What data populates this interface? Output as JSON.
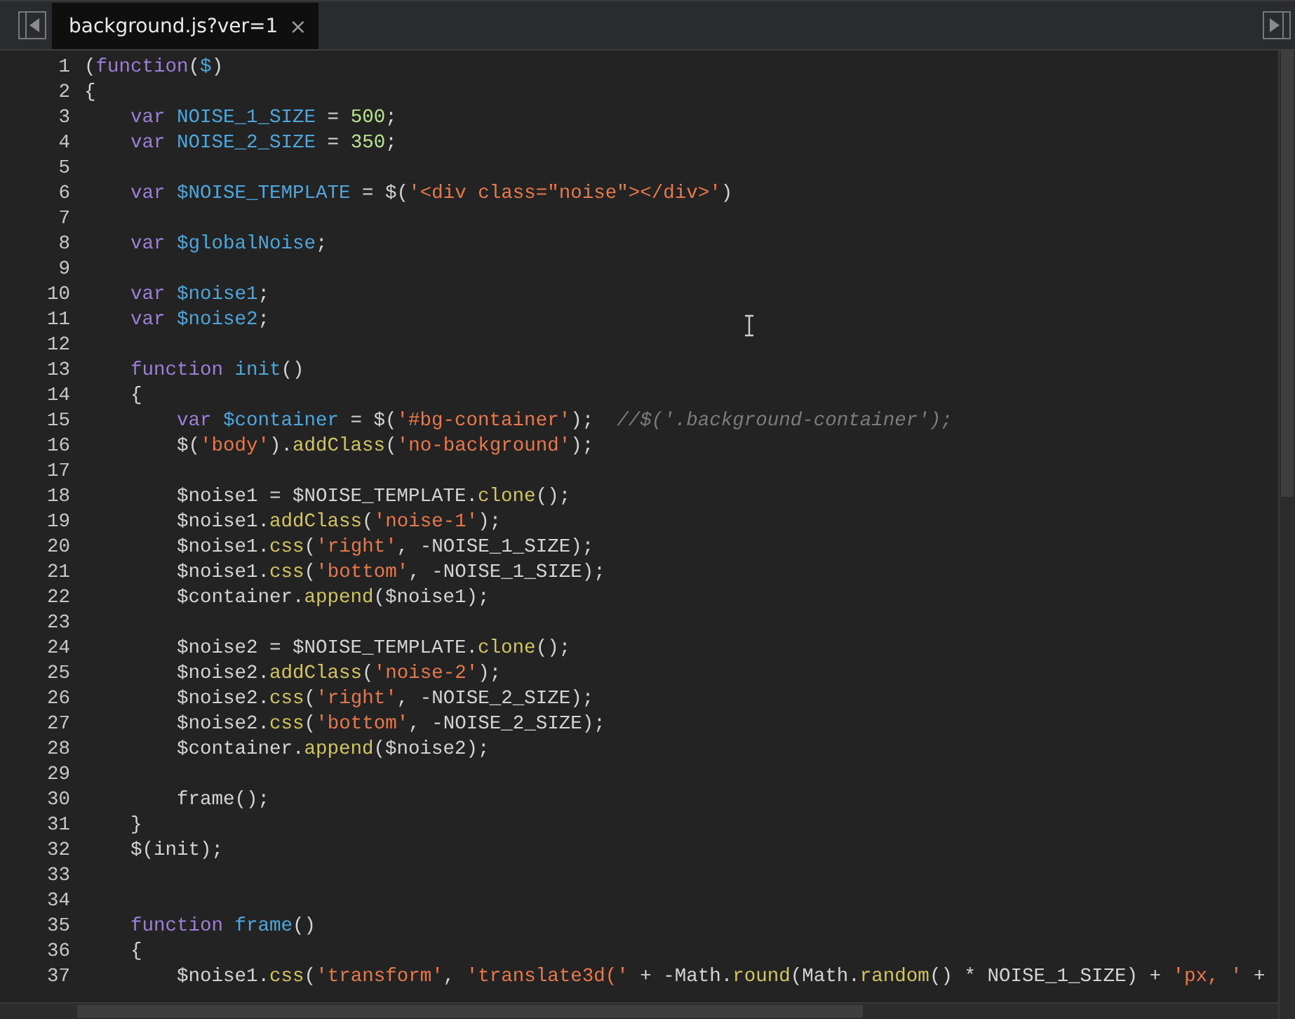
{
  "tabs": [
    {
      "label": "background.js?ver=1",
      "close": "×",
      "selected": true
    }
  ],
  "code_lines": [
    {
      "number": "1",
      "tokens": [
        {
          "kind": "plain",
          "text": "("
        },
        {
          "kind": "keyword",
          "text": "function"
        },
        {
          "kind": "plain",
          "text": "("
        },
        {
          "kind": "ident",
          "text": "$"
        },
        {
          "kind": "plain",
          "text": ")"
        }
      ]
    },
    {
      "number": "2",
      "tokens": [
        {
          "kind": "plain",
          "text": "{"
        }
      ]
    },
    {
      "number": "3",
      "tokens": [
        {
          "kind": "keyword",
          "text": "    var"
        },
        {
          "kind": "ident",
          "text": " NOISE_1_SIZE"
        },
        {
          "kind": "plain",
          "text": " = "
        },
        {
          "kind": "number",
          "text": "500"
        },
        {
          "kind": "plain",
          "text": ";"
        }
      ]
    },
    {
      "number": "4",
      "tokens": [
        {
          "kind": "keyword",
          "text": "    var"
        },
        {
          "kind": "ident",
          "text": " NOISE_2_SIZE"
        },
        {
          "kind": "plain",
          "text": " = "
        },
        {
          "kind": "number",
          "text": "350"
        },
        {
          "kind": "plain",
          "text": ";"
        }
      ]
    },
    {
      "number": "5"
    },
    {
      "number": "6",
      "tokens": [
        {
          "kind": "keyword",
          "text": "    var"
        },
        {
          "kind": "ident",
          "text": " $NOISE_TEMPLATE"
        },
        {
          "kind": "plain",
          "text": " = $("
        },
        {
          "kind": "string",
          "text": "'<div class=\"noise\"></div>'"
        },
        {
          "kind": "plain",
          "text": ")"
        }
      ]
    },
    {
      "number": "7"
    },
    {
      "number": "8",
      "tokens": [
        {
          "kind": "keyword",
          "text": "    var"
        },
        {
          "kind": "ident",
          "text": " $globalNoise"
        },
        {
          "kind": "plain",
          "text": ";"
        }
      ]
    },
    {
      "number": "9"
    },
    {
      "number": "10",
      "tokens": [
        {
          "kind": "keyword",
          "text": "    var"
        },
        {
          "kind": "ident",
          "text": " $noise1"
        },
        {
          "kind": "plain",
          "text": ";"
        }
      ]
    },
    {
      "number": "11",
      "tokens": [
        {
          "kind": "keyword",
          "text": "    var"
        },
        {
          "kind": "ident",
          "text": " $noise2"
        },
        {
          "kind": "plain",
          "text": ";"
        }
      ]
    },
    {
      "number": "12"
    },
    {
      "number": "13",
      "tokens": [
        {
          "kind": "keyword",
          "text": "    function"
        },
        {
          "kind": "ident",
          "text": " init"
        },
        {
          "kind": "plain",
          "text": "()"
        }
      ]
    },
    {
      "number": "14",
      "tokens": [
        {
          "kind": "plain",
          "text": "    {"
        }
      ]
    },
    {
      "number": "15",
      "tokens": [
        {
          "kind": "keyword",
          "text": "        var"
        },
        {
          "kind": "ident",
          "text": " $container"
        },
        {
          "kind": "plain",
          "text": " = $("
        },
        {
          "kind": "string",
          "text": "'#bg-container'"
        },
        {
          "kind": "plain",
          "text": ");"
        },
        {
          "kind": "comment",
          "text": "  //$('.background-container');"
        }
      ]
    },
    {
      "number": "16",
      "tokens": [
        {
          "kind": "plain",
          "text": "        $("
        },
        {
          "kind": "string",
          "text": "'body'"
        },
        {
          "kind": "plain",
          "text": ")."
        },
        {
          "kind": "method",
          "text": "addClass"
        },
        {
          "kind": "plain",
          "text": "("
        },
        {
          "kind": "string",
          "text": "'no-background'"
        },
        {
          "kind": "plain",
          "text": ");"
        }
      ]
    },
    {
      "number": "17"
    },
    {
      "number": "18",
      "tokens": [
        {
          "kind": "plain",
          "text": "        $noise1 = $NOISE_TEMPLATE."
        },
        {
          "kind": "method",
          "text": "clone"
        },
        {
          "kind": "plain",
          "text": "();"
        }
      ]
    },
    {
      "number": "19",
      "tokens": [
        {
          "kind": "plain",
          "text": "        $noise1."
        },
        {
          "kind": "method",
          "text": "addClass"
        },
        {
          "kind": "plain",
          "text": "("
        },
        {
          "kind": "string",
          "text": "'noise-1'"
        },
        {
          "kind": "plain",
          "text": ");"
        }
      ]
    },
    {
      "number": "20",
      "tokens": [
        {
          "kind": "plain",
          "text": "        $noise1."
        },
        {
          "kind": "method",
          "text": "css"
        },
        {
          "kind": "plain",
          "text": "("
        },
        {
          "kind": "string",
          "text": "'right'"
        },
        {
          "kind": "plain",
          "text": ", -NOISE_1_SIZE);"
        }
      ]
    },
    {
      "number": "21",
      "tokens": [
        {
          "kind": "plain",
          "text": "        $noise1."
        },
        {
          "kind": "method",
          "text": "css"
        },
        {
          "kind": "plain",
          "text": "("
        },
        {
          "kind": "string",
          "text": "'bottom'"
        },
        {
          "kind": "plain",
          "text": ", -NOISE_1_SIZE);"
        }
      ]
    },
    {
      "number": "22",
      "tokens": [
        {
          "kind": "plain",
          "text": "        $container."
        },
        {
          "kind": "method",
          "text": "append"
        },
        {
          "kind": "plain",
          "text": "($noise1);"
        }
      ]
    },
    {
      "number": "23"
    },
    {
      "number": "24",
      "tokens": [
        {
          "kind": "plain",
          "text": "        $noise2 = $NOISE_TEMPLATE."
        },
        {
          "kind": "method",
          "text": "clone"
        },
        {
          "kind": "plain",
          "text": "();"
        }
      ]
    },
    {
      "number": "25",
      "tokens": [
        {
          "kind": "plain",
          "text": "        $noise2."
        },
        {
          "kind": "method",
          "text": "addClass"
        },
        {
          "kind": "plain",
          "text": "("
        },
        {
          "kind": "string",
          "text": "'noise-2'"
        },
        {
          "kind": "plain",
          "text": ");"
        }
      ]
    },
    {
      "number": "26",
      "tokens": [
        {
          "kind": "plain",
          "text": "        $noise2."
        },
        {
          "kind": "method",
          "text": "css"
        },
        {
          "kind": "plain",
          "text": "("
        },
        {
          "kind": "string",
          "text": "'right'"
        },
        {
          "kind": "plain",
          "text": ", -NOISE_2_SIZE);"
        }
      ]
    },
    {
      "number": "27",
      "tokens": [
        {
          "kind": "plain",
          "text": "        $noise2."
        },
        {
          "kind": "method",
          "text": "css"
        },
        {
          "kind": "plain",
          "text": "("
        },
        {
          "kind": "string",
          "text": "'bottom'"
        },
        {
          "kind": "plain",
          "text": ", -NOISE_2_SIZE);"
        }
      ]
    },
    {
      "number": "28",
      "tokens": [
        {
          "kind": "plain",
          "text": "        $container."
        },
        {
          "kind": "method",
          "text": "append"
        },
        {
          "kind": "plain",
          "text": "($noise2);"
        }
      ]
    },
    {
      "number": "29"
    },
    {
      "number": "30",
      "tokens": [
        {
          "kind": "plain",
          "text": "        frame();"
        }
      ]
    },
    {
      "number": "31",
      "tokens": [
        {
          "kind": "plain",
          "text": "    }"
        }
      ]
    },
    {
      "number": "32",
      "tokens": [
        {
          "kind": "plain",
          "text": "    $(init);"
        }
      ]
    },
    {
      "number": "33"
    },
    {
      "number": "34"
    },
    {
      "number": "35",
      "tokens": [
        {
          "kind": "keyword",
          "text": "    function"
        },
        {
          "kind": "ident",
          "text": " frame"
        },
        {
          "kind": "plain",
          "text": "()"
        }
      ]
    },
    {
      "number": "36",
      "tokens": [
        {
          "kind": "plain",
          "text": "    {"
        }
      ]
    },
    {
      "number": "37",
      "tokens": [
        {
          "kind": "plain",
          "text": "        $noise1."
        },
        {
          "kind": "method",
          "text": "css"
        },
        {
          "kind": "plain",
          "text": "("
        },
        {
          "kind": "string",
          "text": "'transform'"
        },
        {
          "kind": "plain",
          "text": ", "
        },
        {
          "kind": "string",
          "text": "'translate3d('"
        },
        {
          "kind": "plain",
          "text": " + -Math."
        },
        {
          "kind": "method",
          "text": "round"
        },
        {
          "kind": "plain",
          "text": "(Math."
        },
        {
          "kind": "method",
          "text": "random"
        },
        {
          "kind": "plain",
          "text": "() * NOISE_1_SIZE) + "
        },
        {
          "kind": "string",
          "text": "'px, '"
        },
        {
          "kind": "plain",
          "text": " +"
        }
      ]
    }
  ]
}
